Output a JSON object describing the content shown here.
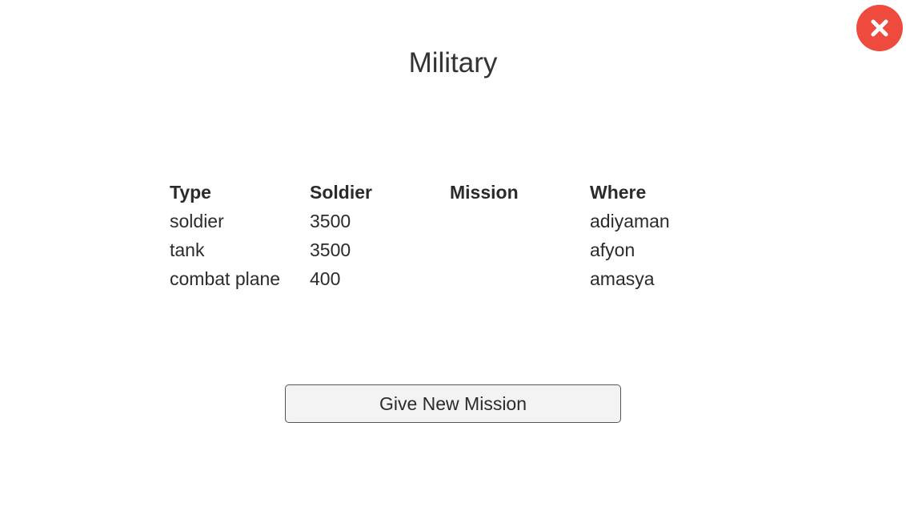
{
  "window": {
    "title": "Military",
    "close_icon": "close-icon",
    "accent_color": "#ee4a3d"
  },
  "table": {
    "headers": [
      "Type",
      "Soldier",
      "Mission",
      "Where"
    ],
    "rows": [
      [
        "soldier",
        "3500",
        "",
        "adiyaman"
      ],
      [
        "tank",
        "3500",
        "",
        "afyon"
      ],
      [
        "combat plane",
        "400",
        "",
        "amasya"
      ]
    ]
  },
  "actions": {
    "give_mission_label": "Give New Mission"
  }
}
